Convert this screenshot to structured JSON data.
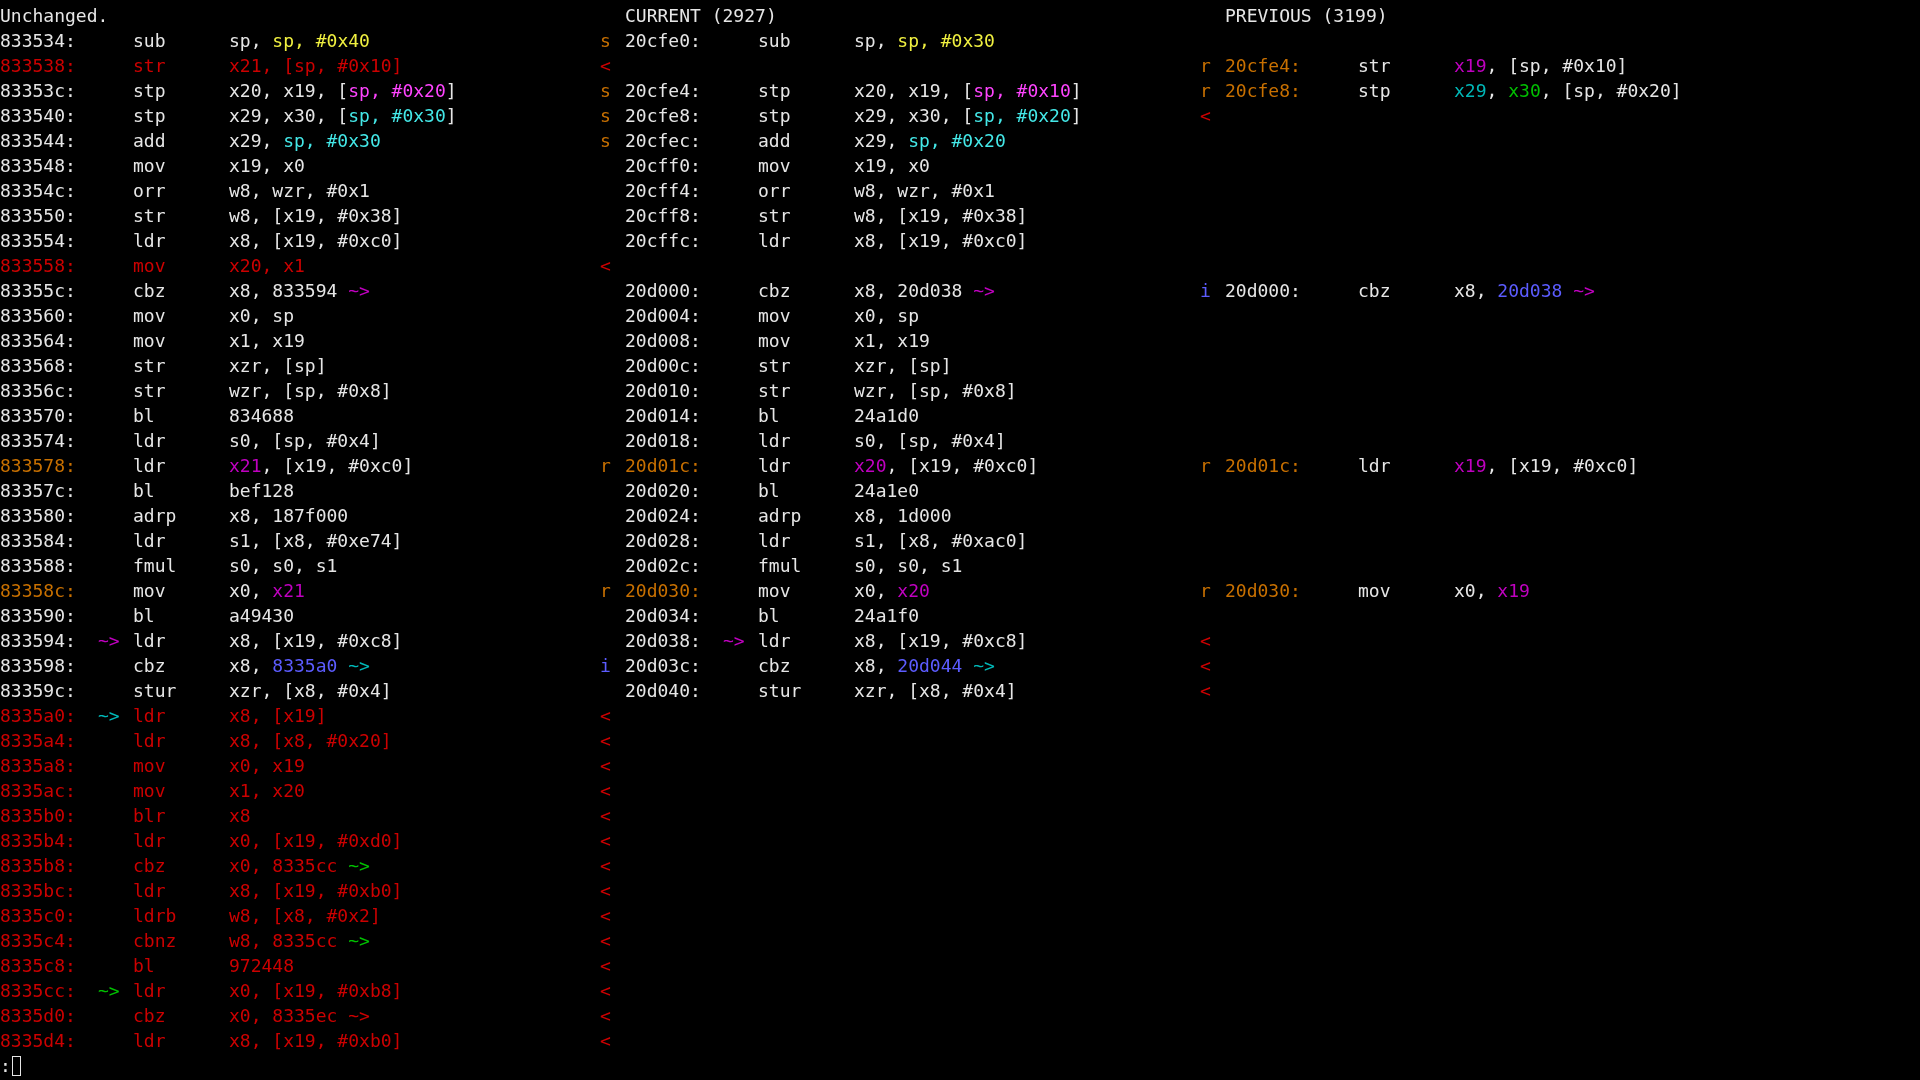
{
  "headers": [
    "Unchanged.",
    "CURRENT (2927)",
    "PREVIOUS (3199)"
  ],
  "rows": [
    {
      "left": {
        "kind": "normal",
        "address": "833534:",
        "mnemonic": "sub",
        "operands": [
          "sp, ",
          {
            "text": "sp, #0x40",
            "color": "#f0f040"
          }
        ]
      },
      "current": {
        "kind": "normal",
        "marker": {
          "text": "s",
          "color": "#c87000"
        },
        "address": "20cfe0:",
        "mnemonic": "sub",
        "operands": [
          "sp, ",
          {
            "text": "sp, #0x30",
            "color": "#f0f040"
          }
        ]
      }
    },
    {
      "left": {
        "kind": "removed",
        "address": "833538:",
        "mnemonic": "str",
        "operands": [
          "x21, [sp, #0x10]"
        ]
      },
      "current": {
        "marker": {
          "text": "<",
          "color": "#cc0000"
        }
      },
      "previous": {
        "kind": "changed",
        "marker": {
          "text": "r",
          "color": "#c87000"
        },
        "address": "20cfe4:",
        "mnemonic": "str",
        "operands": [
          {
            "text": "x19",
            "color": "#c000c0"
          },
          ", [sp, #0x10]"
        ]
      }
    },
    {
      "left": {
        "kind": "normal",
        "address": "83353c:",
        "mnemonic": "stp",
        "operands": [
          "x20, x19, [",
          {
            "text": "sp, #0x20",
            "color": "#ff44ff"
          },
          "]"
        ]
      },
      "current": {
        "kind": "normal",
        "marker": {
          "text": "s",
          "color": "#c87000"
        },
        "address": "20cfe4:",
        "mnemonic": "stp",
        "operands": [
          "x20, x19, [",
          {
            "text": "sp, #0x10",
            "color": "#ff44ff"
          },
          "]"
        ]
      },
      "previous": {
        "kind": "changed",
        "marker": {
          "text": "r",
          "color": "#c87000"
        },
        "address": "20cfe8:",
        "mnemonic": "stp",
        "operands": [
          {
            "text": "x29",
            "color": "#00b8b8"
          },
          ", ",
          {
            "text": "x30",
            "color": "#00c000"
          },
          ", [sp, #0x20]"
        ]
      }
    },
    {
      "left": {
        "kind": "normal",
        "address": "833540:",
        "mnemonic": "stp",
        "operands": [
          "x29, x30, [",
          {
            "text": "sp, #0x30",
            "color": "#44e8e8"
          },
          "]"
        ]
      },
      "current": {
        "kind": "normal",
        "marker": {
          "text": "s",
          "color": "#c87000"
        },
        "address": "20cfe8:",
        "mnemonic": "stp",
        "operands": [
          "x29, x30, [",
          {
            "text": "sp, #0x20",
            "color": "#44e8e8"
          },
          "]"
        ]
      },
      "previous": {
        "marker": {
          "text": "<",
          "color": "#cc0000"
        }
      }
    },
    {
      "left": {
        "kind": "normal",
        "address": "833544:",
        "mnemonic": "add",
        "operands": [
          "x29, ",
          {
            "text": "sp, #0x30",
            "color": "#44e8e8"
          }
        ]
      },
      "current": {
        "kind": "normal",
        "marker": {
          "text": "s",
          "color": "#c87000"
        },
        "address": "20cfec:",
        "mnemonic": "add",
        "operands": [
          "x29, ",
          {
            "text": "sp, #0x20",
            "color": "#44e8e8"
          }
        ]
      }
    },
    {
      "left": {
        "kind": "normal",
        "address": "833548:",
        "mnemonic": "mov",
        "operands": [
          "x19, x0"
        ]
      },
      "current": {
        "kind": "normal",
        "address": "20cff0:",
        "mnemonic": "mov",
        "operands": [
          "x19, x0"
        ]
      }
    },
    {
      "left": {
        "kind": "normal",
        "address": "83354c:",
        "mnemonic": "orr",
        "operands": [
          "w8, wzr, #0x1"
        ]
      },
      "current": {
        "kind": "normal",
        "address": "20cff4:",
        "mnemonic": "orr",
        "operands": [
          "w8, wzr, #0x1"
        ]
      }
    },
    {
      "left": {
        "kind": "normal",
        "address": "833550:",
        "mnemonic": "str",
        "operands": [
          "w8, [x19, #0x38]"
        ]
      },
      "current": {
        "kind": "normal",
        "address": "20cff8:",
        "mnemonic": "str",
        "operands": [
          "w8, [x19, #0x38]"
        ]
      }
    },
    {
      "left": {
        "kind": "normal",
        "address": "833554:",
        "mnemonic": "ldr",
        "operands": [
          "x8, [x19, #0xc0]"
        ]
      },
      "current": {
        "kind": "normal",
        "address": "20cffc:",
        "mnemonic": "ldr",
        "operands": [
          "x8, [x19, #0xc0]"
        ]
      }
    },
    {
      "left": {
        "kind": "removed",
        "address": "833558:",
        "mnemonic": "mov",
        "operands": [
          "x20, x1"
        ]
      },
      "current": {
        "marker": {
          "text": "<",
          "color": "#cc0000"
        }
      }
    },
    {
      "left": {
        "kind": "normal",
        "address": "83355c:",
        "mnemonic": "cbz",
        "operands": [
          "x8, 833594 ",
          {
            "text": "~>",
            "color": "#c000c0"
          }
        ]
      },
      "current": {
        "kind": "normal",
        "address": "20d000:",
        "mnemonic": "cbz",
        "operands": [
          "x8, 20d038 ",
          {
            "text": "~>",
            "color": "#c000c0"
          }
        ]
      },
      "previous": {
        "kind": "normal",
        "marker": {
          "text": "i",
          "color": "#5c5cff"
        },
        "address": "20d000:",
        "mnemonic": "cbz",
        "operands": [
          "x8, ",
          {
            "text": "20d038 ",
            "color": "#5c5cff"
          },
          {
            "text": "~>",
            "color": "#c000c0"
          }
        ]
      }
    },
    {
      "left": {
        "kind": "normal",
        "address": "833560:",
        "mnemonic": "mov",
        "operands": [
          "x0, sp"
        ]
      },
      "current": {
        "kind": "normal",
        "address": "20d004:",
        "mnemonic": "mov",
        "operands": [
          "x0, sp"
        ]
      }
    },
    {
      "left": {
        "kind": "normal",
        "address": "833564:",
        "mnemonic": "mov",
        "operands": [
          "x1, x19"
        ]
      },
      "current": {
        "kind": "normal",
        "address": "20d008:",
        "mnemonic": "mov",
        "operands": [
          "x1, x19"
        ]
      }
    },
    {
      "left": {
        "kind": "normal",
        "address": "833568:",
        "mnemonic": "str",
        "operands": [
          "xzr, [sp]"
        ]
      },
      "current": {
        "kind": "normal",
        "address": "20d00c:",
        "mnemonic": "str",
        "operands": [
          "xzr, [sp]"
        ]
      }
    },
    {
      "left": {
        "kind": "normal",
        "address": "83356c:",
        "mnemonic": "str",
        "operands": [
          "wzr, [sp, #0x8]"
        ]
      },
      "current": {
        "kind": "normal",
        "address": "20d010:",
        "mnemonic": "str",
        "operands": [
          "wzr, [sp, #0x8]"
        ]
      }
    },
    {
      "left": {
        "kind": "normal",
        "address": "833570:",
        "mnemonic": "bl",
        "operands": [
          "834688"
        ]
      },
      "current": {
        "kind": "normal",
        "address": "20d014:",
        "mnemonic": "bl",
        "operands": [
          "24a1d0"
        ]
      }
    },
    {
      "left": {
        "kind": "normal",
        "address": "833574:",
        "mnemonic": "ldr",
        "operands": [
          "s0, [sp, #0x4]"
        ]
      },
      "current": {
        "kind": "normal",
        "address": "20d018:",
        "mnemonic": "ldr",
        "operands": [
          "s0, [sp, #0x4]"
        ]
      }
    },
    {
      "left": {
        "kind": "changed",
        "address": "833578:",
        "mnemonic": "ldr",
        "operands": [
          {
            "text": "x21",
            "color": "#c000c0"
          },
          ", [x19, #0xc0]"
        ]
      },
      "current": {
        "kind": "changed",
        "marker": {
          "text": "r",
          "color": "#c87000"
        },
        "address": "20d01c:",
        "mnemonic": "ldr",
        "operands": [
          {
            "text": "x20",
            "color": "#c000c0"
          },
          ", [x19, #0xc0]"
        ]
      },
      "previous": {
        "kind": "changed",
        "marker": {
          "text": "r",
          "color": "#c87000"
        },
        "address": "20d01c:",
        "mnemonic": "ldr",
        "operands": [
          {
            "text": "x19",
            "color": "#c000c0"
          },
          ", [x19, #0xc0]"
        ]
      }
    },
    {
      "left": {
        "kind": "normal",
        "address": "83357c:",
        "mnemonic": "bl",
        "operands": [
          "bef128"
        ]
      },
      "current": {
        "kind": "normal",
        "address": "20d020:",
        "mnemonic": "bl",
        "operands": [
          "24a1e0"
        ]
      }
    },
    {
      "left": {
        "kind": "normal",
        "address": "833580:",
        "mnemonic": "adrp",
        "operands": [
          "x8, 187f000"
        ]
      },
      "current": {
        "kind": "normal",
        "address": "20d024:",
        "mnemonic": "adrp",
        "operands": [
          "x8, 1d000"
        ]
      }
    },
    {
      "left": {
        "kind": "normal",
        "address": "833584:",
        "mnemonic": "ldr",
        "operands": [
          "s1, [x8, #0xe74]"
        ]
      },
      "current": {
        "kind": "normal",
        "address": "20d028:",
        "mnemonic": "ldr",
        "operands": [
          "s1, [x8, #0xac0]"
        ]
      }
    },
    {
      "left": {
        "kind": "normal",
        "address": "833588:",
        "mnemonic": "fmul",
        "operands": [
          "s0, s0, s1"
        ]
      },
      "current": {
        "kind": "normal",
        "address": "20d02c:",
        "mnemonic": "fmul",
        "operands": [
          "s0, s0, s1"
        ]
      }
    },
    {
      "left": {
        "kind": "changed",
        "address": "83358c:",
        "mnemonic": "mov",
        "operands": [
          "x0, ",
          {
            "text": "x21",
            "color": "#c000c0"
          }
        ]
      },
      "current": {
        "kind": "changed",
        "marker": {
          "text": "r",
          "color": "#c87000"
        },
        "address": "20d030:",
        "mnemonic": "mov",
        "operands": [
          "x0, ",
          {
            "text": "x20",
            "color": "#c000c0"
          }
        ]
      },
      "previous": {
        "kind": "changed",
        "marker": {
          "text": "r",
          "color": "#c87000"
        },
        "address": "20d030:",
        "mnemonic": "mov",
        "operands": [
          "x0, ",
          {
            "text": "x19",
            "color": "#c000c0"
          }
        ]
      }
    },
    {
      "left": {
        "kind": "normal",
        "address": "833590:",
        "mnemonic": "bl",
        "operands": [
          "a49430"
        ]
      },
      "current": {
        "kind": "normal",
        "address": "20d034:",
        "mnemonic": "bl",
        "operands": [
          "24a1f0"
        ]
      }
    },
    {
      "left": {
        "kind": "normal",
        "address": "833594:",
        "arrow": {
          "text": "~>",
          "color": "#c000c0"
        },
        "mnemonic": "ldr",
        "operands": [
          "x8, [x19, #0xc8]"
        ]
      },
      "current": {
        "kind": "normal",
        "address": "20d038:",
        "arrow": {
          "text": "~>",
          "color": "#c000c0"
        },
        "mnemonic": "ldr",
        "operands": [
          "x8, [x19, #0xc8]"
        ]
      },
      "previous": {
        "marker": {
          "text": "<",
          "color": "#cc0000"
        }
      }
    },
    {
      "left": {
        "kind": "normal",
        "address": "833598:",
        "mnemonic": "cbz",
        "operands": [
          "x8, ",
          {
            "text": "8335a0 ",
            "color": "#5c5cff"
          },
          {
            "text": "~>",
            "color": "#00b8b8"
          }
        ]
      },
      "current": {
        "kind": "normal",
        "marker": {
          "text": "i",
          "color": "#5c5cff"
        },
        "address": "20d03c:",
        "mnemonic": "cbz",
        "operands": [
          "x8, ",
          {
            "text": "20d044 ",
            "color": "#5c5cff"
          },
          {
            "text": "~>",
            "color": "#00b8b8"
          }
        ]
      },
      "previous": {
        "marker": {
          "text": "<",
          "color": "#cc0000"
        }
      }
    },
    {
      "left": {
        "kind": "normal",
        "address": "83359c:",
        "mnemonic": "stur",
        "operands": [
          "xzr, [x8, #0x4]"
        ]
      },
      "current": {
        "kind": "normal",
        "address": "20d040:",
        "mnemonic": "stur",
        "operands": [
          "xzr, [x8, #0x4]"
        ]
      },
      "previous": {
        "marker": {
          "text": "<",
          "color": "#cc0000"
        }
      }
    },
    {
      "left": {
        "kind": "removed",
        "address": "8335a0:",
        "arrow": {
          "text": "~>",
          "color": "#00b8b8"
        },
        "mnemonic": "ldr",
        "operands": [
          "x8, [x19]"
        ]
      },
      "current": {
        "marker": {
          "text": "<",
          "color": "#cc0000"
        }
      }
    },
    {
      "left": {
        "kind": "removed",
        "address": "8335a4:",
        "mnemonic": "ldr",
        "operands": [
          "x8, [x8, #0x20]"
        ]
      },
      "current": {
        "marker": {
          "text": "<",
          "color": "#cc0000"
        }
      }
    },
    {
      "left": {
        "kind": "removed",
        "address": "8335a8:",
        "mnemonic": "mov",
        "operands": [
          "x0, x19"
        ]
      },
      "current": {
        "marker": {
          "text": "<",
          "color": "#cc0000"
        }
      }
    },
    {
      "left": {
        "kind": "removed",
        "address": "8335ac:",
        "mnemonic": "mov",
        "operands": [
          "x1, x20"
        ]
      },
      "current": {
        "marker": {
          "text": "<",
          "color": "#cc0000"
        }
      }
    },
    {
      "left": {
        "kind": "removed",
        "address": "8335b0:",
        "mnemonic": "blr",
        "operands": [
          "x8"
        ]
      },
      "current": {
        "marker": {
          "text": "<",
          "color": "#cc0000"
        }
      }
    },
    {
      "left": {
        "kind": "removed",
        "address": "8335b4:",
        "mnemonic": "ldr",
        "operands": [
          "x0, [x19, #0xd0]"
        ]
      },
      "current": {
        "marker": {
          "text": "<",
          "color": "#cc0000"
        }
      }
    },
    {
      "left": {
        "kind": "removed",
        "address": "8335b8:",
        "mnemonic": "cbz",
        "operands": [
          "x0, 8335cc ",
          {
            "text": "~>",
            "color": "#00c000"
          }
        ]
      },
      "current": {
        "marker": {
          "text": "<",
          "color": "#cc0000"
        }
      }
    },
    {
      "left": {
        "kind": "removed",
        "address": "8335bc:",
        "mnemonic": "ldr",
        "operands": [
          "x8, [x19, #0xb0]"
        ]
      },
      "current": {
        "marker": {
          "text": "<",
          "color": "#cc0000"
        }
      }
    },
    {
      "left": {
        "kind": "removed",
        "address": "8335c0:",
        "mnemonic": "ldrb",
        "operands": [
          "w8, [x8, #0x2]"
        ]
      },
      "current": {
        "marker": {
          "text": "<",
          "color": "#cc0000"
        }
      }
    },
    {
      "left": {
        "kind": "removed",
        "address": "8335c4:",
        "mnemonic": "cbnz",
        "operands": [
          "w8, 8335cc ",
          {
            "text": "~>",
            "color": "#00c000"
          }
        ]
      },
      "current": {
        "marker": {
          "text": "<",
          "color": "#cc0000"
        }
      }
    },
    {
      "left": {
        "kind": "removed",
        "address": "8335c8:",
        "mnemonic": "bl",
        "operands": [
          "972448"
        ]
      },
      "current": {
        "marker": {
          "text": "<",
          "color": "#cc0000"
        }
      }
    },
    {
      "left": {
        "kind": "removed",
        "address": "8335cc:",
        "arrow": {
          "text": "~>",
          "color": "#00c000"
        },
        "mnemonic": "ldr",
        "operands": [
          "x0, [x19, #0xb8]"
        ]
      },
      "current": {
        "marker": {
          "text": "<",
          "color": "#cc0000"
        }
      }
    },
    {
      "left": {
        "kind": "removed",
        "address": "8335d0:",
        "mnemonic": "cbz",
        "operands": [
          "x0, 8335ec ~>"
        ]
      },
      "current": {
        "marker": {
          "text": "<",
          "color": "#cc0000"
        }
      }
    },
    {
      "left": {
        "kind": "removed",
        "address": "8335d4:",
        "mnemonic": "ldr",
        "operands": [
          "x8, [x19, #0xb0]"
        ]
      },
      "current": {
        "marker": {
          "text": "<",
          "color": "#cc0000"
        }
      }
    }
  ],
  "prompt": {
    "text": ":"
  }
}
